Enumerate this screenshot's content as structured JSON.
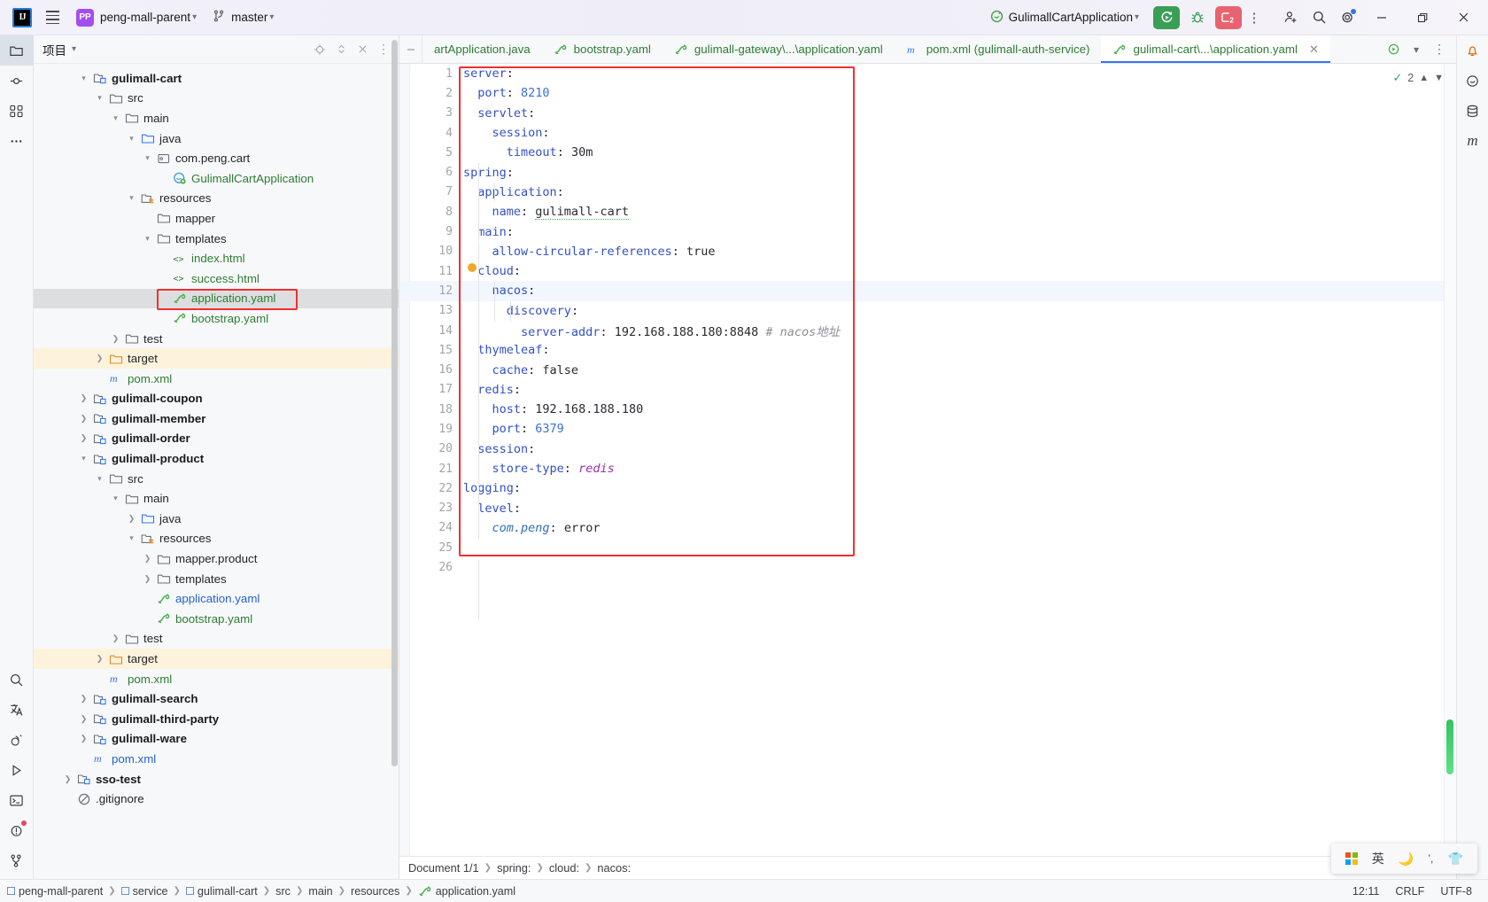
{
  "titlebar": {
    "logo": "IJ",
    "menu_icon": "hamburger-icon",
    "project_badge": "PP",
    "project_name": "peng-mall-parent",
    "branch_icon": "git-branch-icon",
    "branch_name": "master",
    "run_config": "GulimallCartApplication",
    "run_button": "run-icon",
    "debug_button": "debug-icon",
    "stop_button": "stop-icon",
    "stop_count": "2",
    "more_button": "more-vertical-icon",
    "account_icon": "add-user-icon",
    "search_icon": "search-icon",
    "settings_icon": "gear-icon",
    "minimize": "minimize-icon",
    "maximize": "restore-icon",
    "close": "close-icon"
  },
  "left_rail": [
    {
      "name": "project-tool-icon",
      "glyph": "folder",
      "active": true
    },
    {
      "name": "commit-tool-icon",
      "glyph": "commit"
    },
    {
      "name": "structure-tool-icon",
      "glyph": "structure"
    },
    {
      "name": "more-tool-icon",
      "glyph": "dots"
    },
    {
      "name": "search-everywhere-icon",
      "glyph": "search"
    },
    {
      "name": "translate-tool-icon",
      "glyph": "translate"
    },
    {
      "name": "bug-tool-icon",
      "glyph": "bugsnail"
    },
    {
      "name": "run-tool-icon",
      "glyph": "play"
    },
    {
      "name": "terminal-tool-icon",
      "glyph": "terminal"
    },
    {
      "name": "problems-tool-icon",
      "glyph": "warning"
    },
    {
      "name": "git-tool-icon",
      "glyph": "git"
    }
  ],
  "right_rail": [
    {
      "name": "notifications-icon",
      "glyph": "bell"
    },
    {
      "name": "ai-assistant-icon",
      "glyph": "ai"
    },
    {
      "name": "database-icon",
      "glyph": "db"
    },
    {
      "name": "maven-icon",
      "glyph": "m"
    }
  ],
  "project_panel": {
    "title": "项目",
    "actions": [
      "locate-icon",
      "expand-collapse-icon",
      "close-panel-icon",
      "options-icon"
    ],
    "tree": [
      {
        "depth": 2,
        "arrow": "down",
        "icon": "module-icon",
        "label": "gulimall-cart",
        "style": "bold"
      },
      {
        "depth": 3,
        "arrow": "down",
        "icon": "folder-icon",
        "label": "src"
      },
      {
        "depth": 4,
        "arrow": "down",
        "icon": "folder-icon",
        "label": "main"
      },
      {
        "depth": 5,
        "arrow": "down",
        "icon": "source-folder-icon",
        "label": "java"
      },
      {
        "depth": 6,
        "arrow": "down",
        "icon": "package-icon",
        "label": "com.peng.cart"
      },
      {
        "depth": 7,
        "arrow": "none",
        "icon": "spring-class-icon",
        "label": "GulimallCartApplication",
        "style": "green"
      },
      {
        "depth": 5,
        "arrow": "down",
        "icon": "resources-folder-icon",
        "label": "resources"
      },
      {
        "depth": 6,
        "arrow": "none",
        "icon": "folder-icon",
        "label": "mapper"
      },
      {
        "depth": 6,
        "arrow": "down",
        "icon": "folder-icon",
        "label": "templates"
      },
      {
        "depth": 7,
        "arrow": "none",
        "icon": "html-icon",
        "label": "index.html",
        "style": "green"
      },
      {
        "depth": 7,
        "arrow": "none",
        "icon": "html-icon",
        "label": "success.html",
        "style": "green"
      },
      {
        "depth": 7,
        "arrow": "none",
        "icon": "yaml-icon",
        "label": "application.yaml",
        "style": "green",
        "selected": true,
        "highlighted": true
      },
      {
        "depth": 7,
        "arrow": "none",
        "icon": "yaml-icon",
        "label": "bootstrap.yaml",
        "style": "green"
      },
      {
        "depth": 4,
        "arrow": "right",
        "icon": "folder-icon",
        "label": "test"
      },
      {
        "depth": 3,
        "arrow": "right",
        "icon": "target-folder-icon",
        "label": "target",
        "rowStyle": "target"
      },
      {
        "depth": 3,
        "arrow": "none",
        "icon": "maven-pom-icon",
        "label": "pom.xml",
        "style": "green"
      },
      {
        "depth": 2,
        "arrow": "right",
        "icon": "module-icon",
        "label": "gulimall-coupon",
        "style": "bold"
      },
      {
        "depth": 2,
        "arrow": "right",
        "icon": "module-icon",
        "label": "gulimall-member",
        "style": "bold"
      },
      {
        "depth": 2,
        "arrow": "right",
        "icon": "module-icon",
        "label": "gulimall-order",
        "style": "bold"
      },
      {
        "depth": 2,
        "arrow": "down",
        "icon": "module-icon",
        "label": "gulimall-product",
        "style": "bold"
      },
      {
        "depth": 3,
        "arrow": "down",
        "icon": "folder-icon",
        "label": "src"
      },
      {
        "depth": 4,
        "arrow": "down",
        "icon": "folder-icon",
        "label": "main"
      },
      {
        "depth": 5,
        "arrow": "right",
        "icon": "source-folder-icon",
        "label": "java"
      },
      {
        "depth": 5,
        "arrow": "down",
        "icon": "resources-folder-icon",
        "label": "resources"
      },
      {
        "depth": 6,
        "arrow": "right",
        "icon": "folder-icon",
        "label": "mapper.product"
      },
      {
        "depth": 6,
        "arrow": "right",
        "icon": "folder-icon",
        "label": "templates"
      },
      {
        "depth": 6,
        "arrow": "none",
        "icon": "yaml-icon",
        "label": "application.yaml",
        "style": "blue"
      },
      {
        "depth": 6,
        "arrow": "none",
        "icon": "yaml-icon",
        "label": "bootstrap.yaml",
        "style": "green"
      },
      {
        "depth": 4,
        "arrow": "right",
        "icon": "folder-icon",
        "label": "test"
      },
      {
        "depth": 3,
        "arrow": "right",
        "icon": "target-folder-icon",
        "label": "target",
        "rowStyle": "target"
      },
      {
        "depth": 3,
        "arrow": "none",
        "icon": "maven-pom-icon",
        "label": "pom.xml",
        "style": "green"
      },
      {
        "depth": 2,
        "arrow": "right",
        "icon": "module-icon",
        "label": "gulimall-search",
        "style": "bold"
      },
      {
        "depth": 2,
        "arrow": "right",
        "icon": "module-icon",
        "label": "gulimall-third-party",
        "style": "bold"
      },
      {
        "depth": 2,
        "arrow": "right",
        "icon": "module-icon",
        "label": "gulimall-ware",
        "style": "bold"
      },
      {
        "depth": 2,
        "arrow": "none",
        "icon": "maven-pom-icon",
        "label": "pom.xml",
        "style": "blue"
      },
      {
        "depth": 1,
        "arrow": "right",
        "icon": "module-icon",
        "label": "sso-test",
        "style": "bold"
      },
      {
        "depth": 1,
        "arrow": "none",
        "icon": "gitignore-icon",
        "label": ".gitignore"
      }
    ]
  },
  "editor": {
    "tabs": [
      {
        "label": "artApplication.java",
        "icon": "java-class-icon",
        "active": false,
        "truncated": true
      },
      {
        "label": "bootstrap.yaml",
        "icon": "yaml-icon",
        "active": false
      },
      {
        "label": "gulimall-gateway\\...\\application.yaml",
        "icon": "yaml-icon",
        "active": false
      },
      {
        "label": "pom.xml (gulimall-auth-service)",
        "icon": "maven-pom-icon",
        "active": false
      },
      {
        "label": "gulimall-cart\\...\\application.yaml",
        "icon": "yaml-icon",
        "active": true,
        "closable": true
      }
    ],
    "tabs_right_actions": [
      "run-file-icon",
      "chevron-down-icon",
      "options-icon"
    ],
    "inspection": {
      "count": "2",
      "icon": "inspection-check-icon"
    },
    "line_count": 26,
    "current_line": 12,
    "bulb_line": 11,
    "lines": [
      {
        "n": 1,
        "tokens": [
          {
            "t": "server",
            "c": "k"
          },
          {
            "t": ":",
            "c": "val"
          }
        ]
      },
      {
        "n": 2,
        "tokens": [
          {
            "t": "  ",
            "c": "val"
          },
          {
            "t": "port",
            "c": "k"
          },
          {
            "t": ": ",
            "c": "val"
          },
          {
            "t": "8210",
            "c": "num"
          }
        ]
      },
      {
        "n": 3,
        "tokens": [
          {
            "t": "  ",
            "c": "val"
          },
          {
            "t": "servlet",
            "c": "k"
          },
          {
            "t": ":",
            "c": "val"
          }
        ]
      },
      {
        "n": 4,
        "tokens": [
          {
            "t": "    ",
            "c": "val"
          },
          {
            "t": "session",
            "c": "k"
          },
          {
            "t": ":",
            "c": "val"
          }
        ]
      },
      {
        "n": 5,
        "tokens": [
          {
            "t": "      ",
            "c": "val"
          },
          {
            "t": "timeout",
            "c": "k"
          },
          {
            "t": ": ",
            "c": "val"
          },
          {
            "t": "30m",
            "c": "val"
          }
        ]
      },
      {
        "n": 6,
        "tokens": [
          {
            "t": "spring",
            "c": "k"
          },
          {
            "t": ":",
            "c": "val"
          }
        ]
      },
      {
        "n": 7,
        "tokens": [
          {
            "t": "  ",
            "c": "val"
          },
          {
            "t": "application",
            "c": "k"
          },
          {
            "t": ":",
            "c": "val"
          }
        ]
      },
      {
        "n": 8,
        "tokens": [
          {
            "t": "    ",
            "c": "val"
          },
          {
            "t": "name",
            "c": "k"
          },
          {
            "t": ": ",
            "c": "val"
          },
          {
            "t": "gulimall-cart",
            "c": "spell"
          }
        ]
      },
      {
        "n": 9,
        "tokens": [
          {
            "t": "  ",
            "c": "val"
          },
          {
            "t": "main",
            "c": "k"
          },
          {
            "t": ":",
            "c": "val"
          }
        ]
      },
      {
        "n": 10,
        "tokens": [
          {
            "t": "    ",
            "c": "val"
          },
          {
            "t": "allow-circular-references",
            "c": "k"
          },
          {
            "t": ": ",
            "c": "val"
          },
          {
            "t": "true",
            "c": "val"
          }
        ]
      },
      {
        "n": 11,
        "tokens": [
          {
            "t": "  ",
            "c": "val"
          },
          {
            "t": "cloud",
            "c": "k"
          },
          {
            "t": ":",
            "c": "val"
          }
        ]
      },
      {
        "n": 12,
        "tokens": [
          {
            "t": "    ",
            "c": "val"
          },
          {
            "t": "nacos",
            "c": "k"
          },
          {
            "t": ":",
            "c": "val"
          }
        ]
      },
      {
        "n": 13,
        "tokens": [
          {
            "t": "      ",
            "c": "val"
          },
          {
            "t": "discovery",
            "c": "k"
          },
          {
            "t": ":",
            "c": "val"
          }
        ]
      },
      {
        "n": 14,
        "tokens": [
          {
            "t": "        ",
            "c": "val"
          },
          {
            "t": "server-addr",
            "c": "k"
          },
          {
            "t": ": ",
            "c": "val"
          },
          {
            "t": "192.168.188.180:8848",
            "c": "val"
          },
          {
            "t": " # nacos地址",
            "c": "cmt"
          }
        ]
      },
      {
        "n": 15,
        "tokens": [
          {
            "t": "  ",
            "c": "val"
          },
          {
            "t": "thymeleaf",
            "c": "k"
          },
          {
            "t": ":",
            "c": "val"
          }
        ]
      },
      {
        "n": 16,
        "tokens": [
          {
            "t": "    ",
            "c": "val"
          },
          {
            "t": "cache",
            "c": "k"
          },
          {
            "t": ": ",
            "c": "val"
          },
          {
            "t": "false",
            "c": "val"
          }
        ]
      },
      {
        "n": 17,
        "tokens": [
          {
            "t": "  ",
            "c": "val"
          },
          {
            "t": "redis",
            "c": "k"
          },
          {
            "t": ":",
            "c": "val"
          }
        ]
      },
      {
        "n": 18,
        "tokens": [
          {
            "t": "    ",
            "c": "val"
          },
          {
            "t": "host",
            "c": "k"
          },
          {
            "t": ": ",
            "c": "val"
          },
          {
            "t": "192.168.188.180",
            "c": "val"
          }
        ]
      },
      {
        "n": 19,
        "tokens": [
          {
            "t": "    ",
            "c": "val"
          },
          {
            "t": "port",
            "c": "k"
          },
          {
            "t": ": ",
            "c": "val"
          },
          {
            "t": "6379",
            "c": "num"
          }
        ]
      },
      {
        "n": 20,
        "tokens": [
          {
            "t": "  ",
            "c": "val"
          },
          {
            "t": "session",
            "c": "k"
          },
          {
            "t": ":",
            "c": "val"
          }
        ]
      },
      {
        "n": 21,
        "tokens": [
          {
            "t": "    ",
            "c": "val"
          },
          {
            "t": "store-type",
            "c": "k"
          },
          {
            "t": ": ",
            "c": "val"
          },
          {
            "t": "redis",
            "c": "it"
          }
        ]
      },
      {
        "n": 22,
        "tokens": [
          {
            "t": "logging",
            "c": "k"
          },
          {
            "t": ":",
            "c": "val"
          }
        ]
      },
      {
        "n": 23,
        "tokens": [
          {
            "t": "  ",
            "c": "val"
          },
          {
            "t": "level",
            "c": "k"
          },
          {
            "t": ":",
            "c": "val"
          }
        ]
      },
      {
        "n": 24,
        "tokens": [
          {
            "t": "    ",
            "c": "val"
          },
          {
            "t": "com.peng",
            "c": "it2"
          },
          {
            "t": ": ",
            "c": "val"
          },
          {
            "t": "error",
            "c": "val"
          }
        ]
      },
      {
        "n": 25,
        "tokens": []
      },
      {
        "n": 26,
        "tokens": []
      }
    ],
    "document_status": {
      "document": "Document 1/1",
      "crumbs": [
        "spring:",
        "cloud:",
        "nacos:"
      ]
    }
  },
  "statusbar": {
    "breadcrumb": [
      {
        "label": "peng-mall-parent",
        "icon": "module-icon"
      },
      {
        "label": "service",
        "icon": "module-icon"
      },
      {
        "label": "gulimall-cart",
        "icon": "module-icon"
      },
      {
        "label": "src",
        "icon": ""
      },
      {
        "label": "main",
        "icon": ""
      },
      {
        "label": "resources",
        "icon": ""
      },
      {
        "label": "application.yaml",
        "icon": "yaml-icon"
      }
    ],
    "caret_position": "12:11",
    "line_separator": "CRLF",
    "encoding": "UTF-8"
  },
  "ime": {
    "windows_icon": "windows-logo-icon",
    "mode": "英",
    "moon": "moon-icon",
    "punct": "punctuation-icon",
    "shirt": "skin-icon"
  },
  "colors": {
    "accent": "#3574f0",
    "highlight_box": "#f03030",
    "run_green": "#3b9e56",
    "stop_red": "#e8636f",
    "badge_purple": "#a24df0",
    "target_row": "#fdf3dc",
    "selected_row": "#dcdee0"
  }
}
